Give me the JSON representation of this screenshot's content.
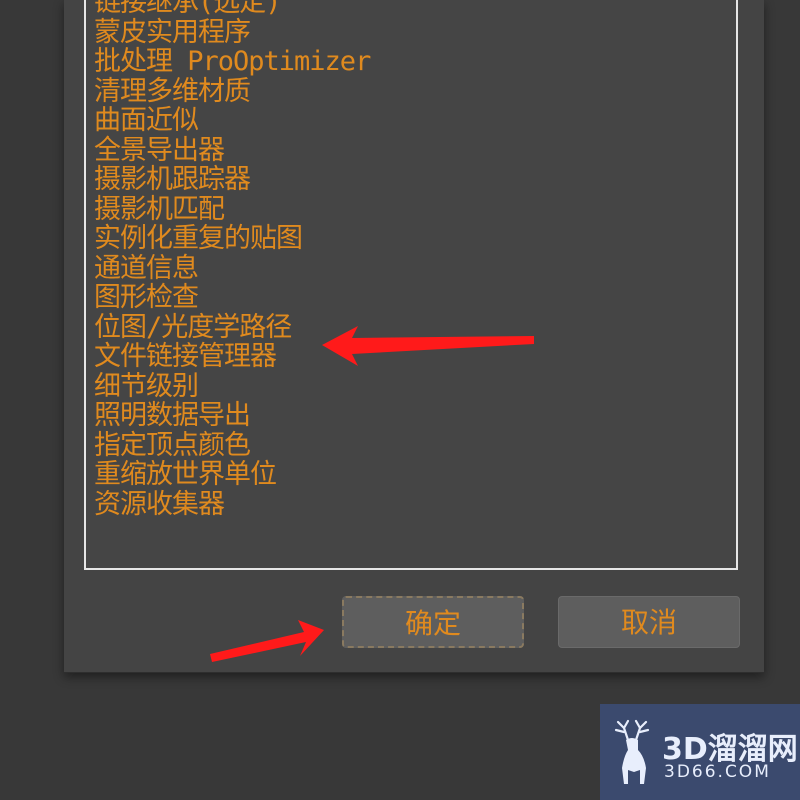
{
  "list": {
    "items": [
      "链接继承(选定)",
      "蒙皮实用程序",
      "批处理 ProOptimizer",
      "清理多维材质",
      "曲面近似",
      "全景导出器",
      "摄影机跟踪器",
      "摄影机匹配",
      "实例化重复的贴图",
      "通道信息",
      "图形检查",
      "位图/光度学路径",
      "文件链接管理器",
      "细节级别",
      "照明数据导出",
      "指定顶点颜色",
      "重缩放世界单位",
      "资源收集器"
    ]
  },
  "buttons": {
    "ok_label": "确定",
    "cancel_label": "取消"
  },
  "watermark": {
    "title": "3D溜溜网",
    "subtitle": "3D66.COM"
  },
  "colors": {
    "text_accent": "#e08a1e",
    "arrow": "#ff1a1a",
    "dialog_bg": "#444444",
    "watermark_bg": "#3b4a6e"
  }
}
